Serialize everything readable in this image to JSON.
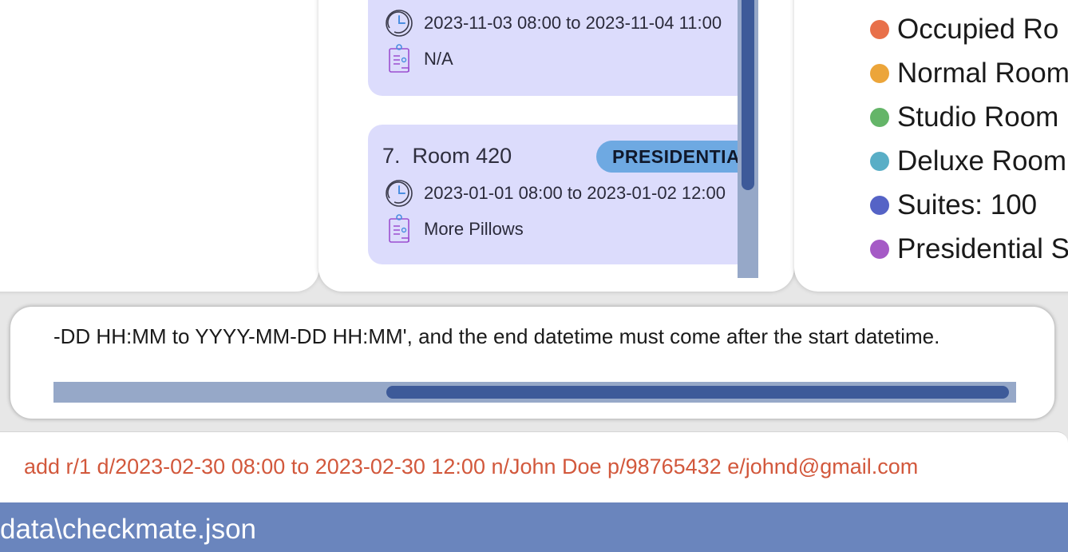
{
  "room_list": {
    "cards": [
      {
        "datetime": "2023-11-03 08:00 to 2023-11-04 11:00",
        "remark": "N/A"
      },
      {
        "index": "7.",
        "room": "Room 420",
        "type": "PRESIDENTIAL",
        "datetime": "2023-01-01 08:00 to 2023-01-02 12:00",
        "remark": "More Pillows"
      }
    ]
  },
  "legend": {
    "items": [
      {
        "label": "Occupied Ro",
        "color": "#e8704a"
      },
      {
        "label": "Normal Room",
        "color": "#eca53a"
      },
      {
        "label": "Studio Room",
        "color": "#64b568"
      },
      {
        "label": "Deluxe Room",
        "color": "#59aec6"
      },
      {
        "label": "Suites: 100",
        "color": "#5563c6"
      },
      {
        "label": "Presidential S",
        "color": "#a55ac6"
      }
    ]
  },
  "result": {
    "text": "-DD HH:MM to YYYY-MM-DD HH:MM', and the end datetime must come after the start datetime."
  },
  "command": {
    "value": "add r/1 d/2023-02-30 08:00 to 2023-02-30 12:00 n/John Doe p/98765432 e/johnd@gmail.com"
  },
  "status": {
    "path": "data\\checkmate.json"
  },
  "icons": {
    "clock": "clock-icon",
    "remark": "clipboard-icon"
  }
}
